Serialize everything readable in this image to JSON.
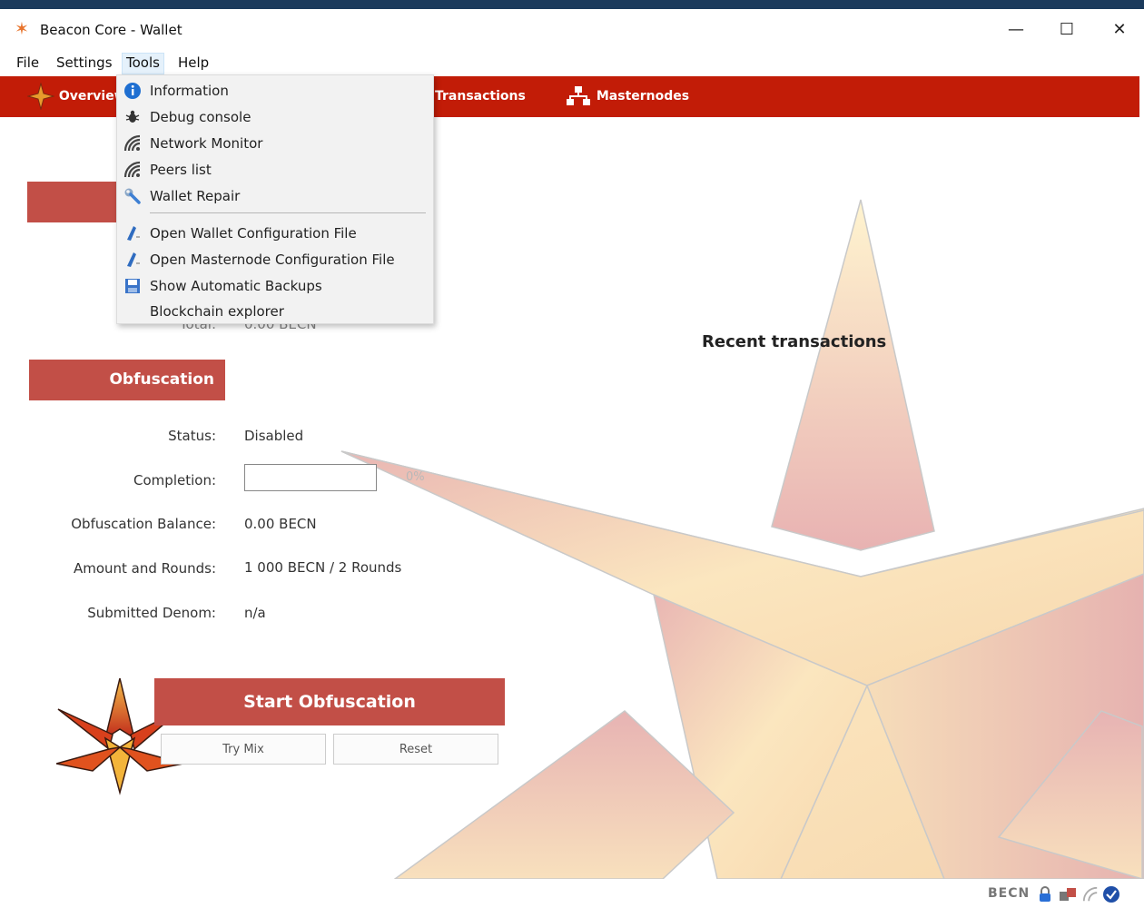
{
  "window": {
    "title": "Beacon Core - Wallet",
    "minimize": "—",
    "maximize": "☐",
    "close": "✕"
  },
  "menu": [
    "File",
    "Settings",
    "Tools",
    "Help"
  ],
  "toolbar": {
    "overview": "Overview",
    "transactions": "Transactions",
    "masternodes": "Masternodes"
  },
  "tools_menu": {
    "items": [
      {
        "label": "Information",
        "icon": "info-icon"
      },
      {
        "label": "Debug console",
        "icon": "bug-icon"
      },
      {
        "label": "Network Monitor",
        "icon": "signal-icon"
      },
      {
        "label": "Peers list",
        "icon": "signal-icon"
      },
      {
        "label": "Wallet Repair",
        "icon": "wrench-icon"
      },
      {
        "label": "Open Wallet Configuration File",
        "icon": "edit-file-icon"
      },
      {
        "label": "Open Masternode Configuration File",
        "icon": "edit-file-icon"
      },
      {
        "label": "Show Automatic Backups",
        "icon": "save-icon"
      },
      {
        "label": "Blockchain explorer",
        "icon": ""
      }
    ]
  },
  "balances": {
    "total_label": "Total:",
    "total_value": "0.00 BECN"
  },
  "obfuscation": {
    "header": "Obfuscation",
    "status_label": "Status:",
    "status_value": "Disabled",
    "completion_label": "Completion:",
    "completion_percent": "0%",
    "balance_label": "Obfuscation Balance:",
    "balance_value": "0.00 BECN",
    "rounds_label": "Amount and Rounds:",
    "rounds_value": "1 000 BECN / 2 Rounds",
    "denom_label": "Submitted Denom:",
    "denom_value": "n/a",
    "start_button": "Start Obfuscation",
    "try_mix_button": "Try Mix",
    "reset_button": "Reset"
  },
  "recent": {
    "title": "Recent transactions"
  },
  "statusbar": {
    "unit": "BECN"
  },
  "colors": {
    "toolbar": "#c21c07",
    "header": "#c24f47",
    "accent": "#e8742c"
  }
}
